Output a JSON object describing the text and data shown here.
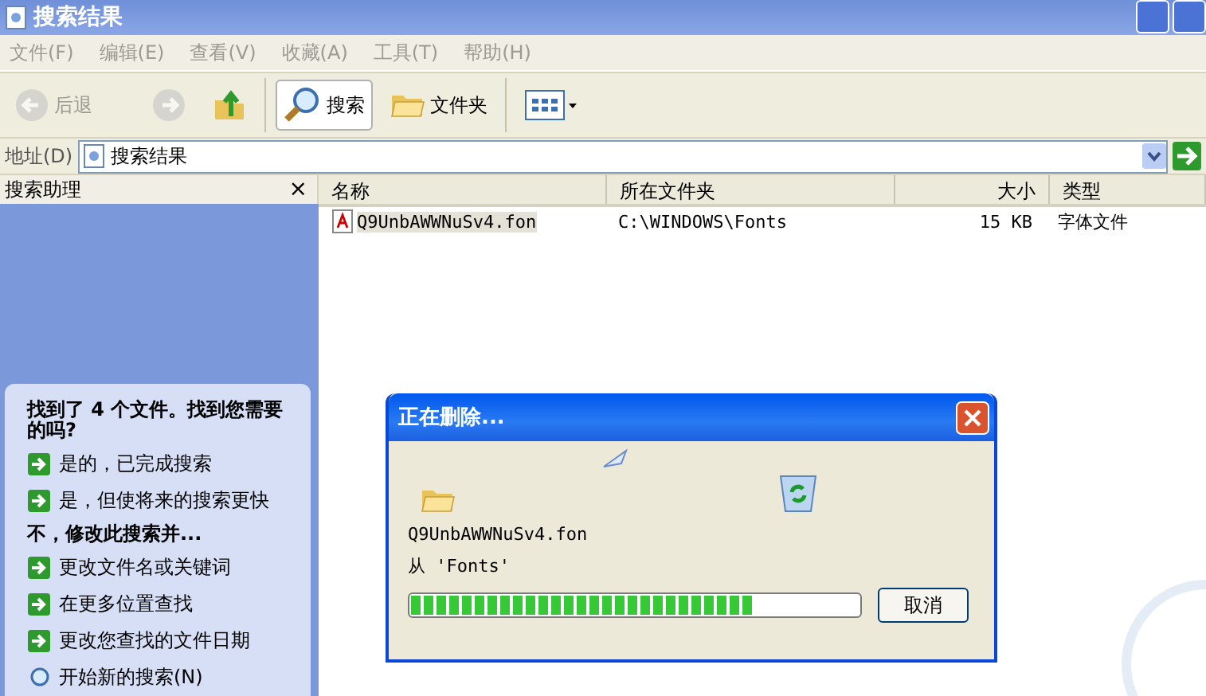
{
  "window": {
    "title": "搜索结果"
  },
  "menu": [
    {
      "label": "文件(F)",
      "disabled": true
    },
    {
      "label": "编辑(E)",
      "disabled": true
    },
    {
      "label": "查看(V)",
      "disabled": true
    },
    {
      "label": "收藏(A)",
      "disabled": true
    },
    {
      "label": "工具(T)",
      "disabled": true
    },
    {
      "label": "帮助(H)",
      "disabled": true
    }
  ],
  "toolbar": [
    {
      "kind": "back",
      "label": "后退",
      "disabled": true
    },
    {
      "kind": "forward",
      "disabled": true
    },
    {
      "kind": "up",
      "disabled": false
    },
    {
      "kind": "search",
      "label": "搜索",
      "selected": true
    },
    {
      "kind": "folders",
      "label": "文件夹",
      "selected": false
    },
    {
      "kind": "views"
    }
  ],
  "address": {
    "label": "地址(D)",
    "value": "搜索结果"
  },
  "search_pane": {
    "title": "搜索助理",
    "close": "×",
    "question": "找到了 4 个文件。找到您需要的吗?",
    "links": [
      {
        "kind": "arrow",
        "label": "是的，已完成搜索"
      },
      {
        "kind": "arrow",
        "label": "是，但使将来的搜索更快"
      },
      {
        "kind": "heading",
        "label": "不，修改此搜索并..."
      },
      {
        "kind": "arrow",
        "label": "更改文件名或关键词"
      },
      {
        "kind": "arrow",
        "label": "在更多位置查找"
      },
      {
        "kind": "arrow",
        "label": "更改您查找的文件日期"
      },
      {
        "kind": "search",
        "label": "开始新的搜索(N)"
      }
    ]
  },
  "table": {
    "columns": [
      "名称",
      "所在文件夹",
      "大小",
      "类型"
    ],
    "rows": [
      {
        "selected": true,
        "cells": [
          "Q9UnbAWWNuSv4.fon",
          "C:\\WINDOWS\\Fonts",
          "15 KB",
          "字体文件"
        ]
      }
    ]
  },
  "dialog": {
    "title": "正在删除...",
    "file": "Q9UnbAWWNuSv4.fon",
    "source": "从 'Fonts'",
    "progress": {
      "level": 0.77
    },
    "cancel": "取消"
  }
}
